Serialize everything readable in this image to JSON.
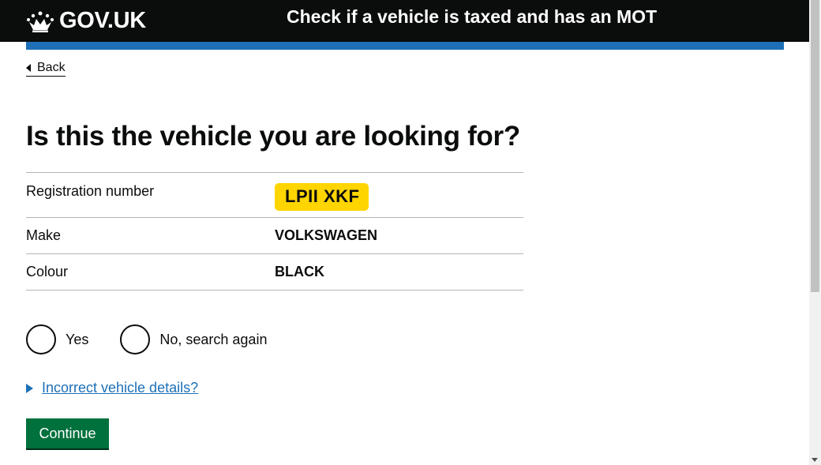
{
  "header": {
    "logo_text": "GOV.UK",
    "service_name": "Check if a vehicle is taxed and has an MOT"
  },
  "nav": {
    "back_label": "Back"
  },
  "page": {
    "title": "Is this the vehicle you are looking for?"
  },
  "summary": {
    "rows": [
      {
        "key": "Registration number",
        "value": "LPII XKF"
      },
      {
        "key": "Make",
        "value": "VOLKSWAGEN"
      },
      {
        "key": "Colour",
        "value": "BLACK"
      }
    ]
  },
  "radios": {
    "options": [
      {
        "label": "Yes",
        "selected": false
      },
      {
        "label": "No, search again",
        "selected": false
      }
    ]
  },
  "details": {
    "summary_label": "Incorrect vehicle details?"
  },
  "actions": {
    "continue_label": "Continue"
  },
  "colors": {
    "header_bg": "#0b0c0c",
    "brand_blue": "#1d70b8",
    "plate_yellow": "#ffd500",
    "button_green": "#00703c"
  }
}
